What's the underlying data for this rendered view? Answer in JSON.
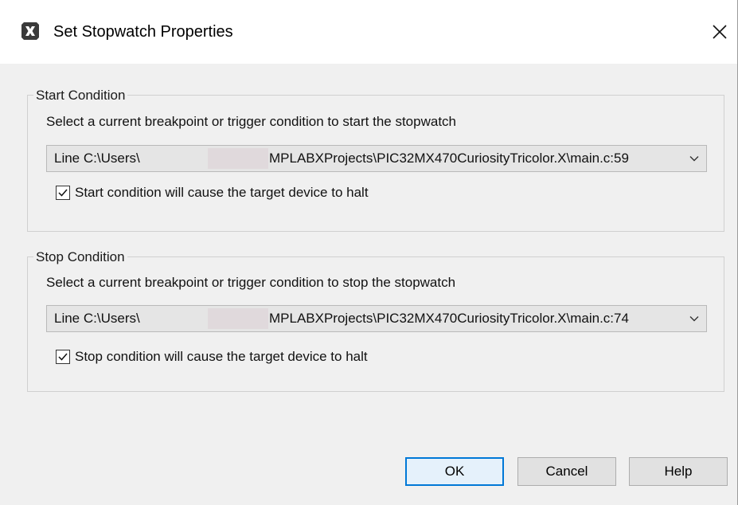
{
  "window": {
    "title": "Set Stopwatch Properties",
    "app_icon": "mplab-x-icon",
    "close_icon": "close-icon"
  },
  "start": {
    "legend": "Start Condition",
    "description": "Select a current breakpoint or trigger condition to start the stopwatch",
    "combo_prefix": "Line C:\\Users\\",
    "combo_suffix": "MPLABXProjects\\PIC32MX470CuriosityTricolor.X\\main.c:59",
    "halt_label": "Start condition will cause the target device to halt",
    "halt_checked": true
  },
  "stop": {
    "legend": "Stop Condition",
    "description": "Select a current breakpoint or trigger condition to stop the stopwatch",
    "combo_prefix": "Line C:\\Users\\",
    "combo_suffix": "MPLABXProjects\\PIC32MX470CuriosityTricolor.X\\main.c:74",
    "halt_label": "Stop condition will cause the target device to halt",
    "halt_checked": true
  },
  "buttons": {
    "ok": "OK",
    "cancel": "Cancel",
    "help": "Help"
  },
  "colors": {
    "accent": "#0078d7",
    "redaction": "#e0d9dc"
  }
}
